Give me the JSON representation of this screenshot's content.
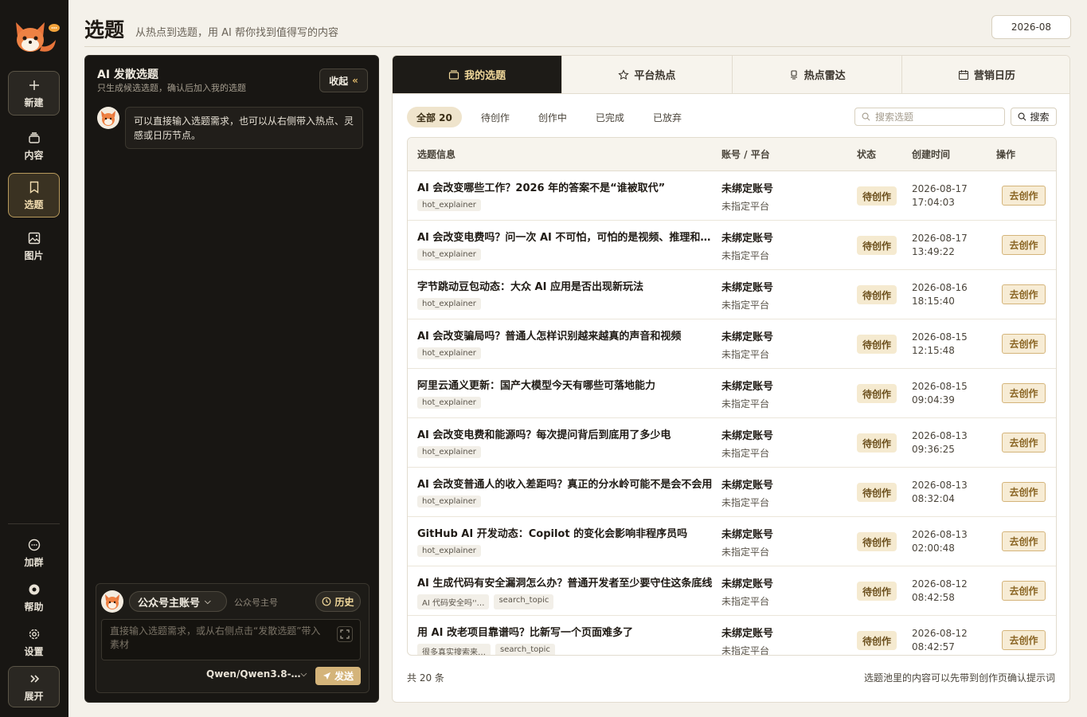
{
  "sidebar": {
    "new_label": "新建",
    "content_label": "内容",
    "topics_label": "选题",
    "images_label": "图片",
    "join_group_label": "加群",
    "help_label": "帮助",
    "settings_label": "设置",
    "expand_label": "展开"
  },
  "header": {
    "title": "选题",
    "subtitle": "从热点到选题，用 AI 帮你找到值得写的内容",
    "date": "2026-08"
  },
  "ai_panel": {
    "title": "AI 发散选题",
    "subtitle": "只生成候选选题，确认后加入我的选题",
    "collapse_label": "收起",
    "message": "可以直接输入选题需求，也可以从右侧带入热点、灵感或日历节点。",
    "account_name": "公众号主账号",
    "account_type": "公众号主号",
    "history_label": "历史",
    "input_placeholder": "直接输入选题需求，或从右侧点击“发散选题”带入素材",
    "model": "Qwen/Qwen3.8-…",
    "send_label": "发送"
  },
  "tabs": [
    {
      "label": "我的选题",
      "icon": "folder-icon"
    },
    {
      "label": "平台热点",
      "icon": "star-icon"
    },
    {
      "label": "热点雷达",
      "icon": "radar-icon"
    },
    {
      "label": "营销日历",
      "icon": "calendar-icon"
    }
  ],
  "filters": [
    "全部 20",
    "待创作",
    "创作中",
    "已完成",
    "已放弃"
  ],
  "search": {
    "placeholder": "搜索选题",
    "button_label": "搜索"
  },
  "table": {
    "headers": {
      "info": "选题信息",
      "account": "账号 / 平台",
      "status": "状态",
      "created": "创建时间",
      "action": "操作"
    },
    "rows": [
      {
        "title": "AI 会改变哪些工作？2026 年的答案不是“谁被取代”",
        "tags": [
          "hot_explainer"
        ],
        "account": "未绑定账号",
        "platform": "未指定平台",
        "status": "待创作",
        "date": "2026-08-17",
        "time": "17:04:03",
        "action": "去创作"
      },
      {
        "title": "AI 会改变电费吗？问一次 AI 不可怕，可怕的是视频、推理和智…",
        "tags": [
          "hot_explainer"
        ],
        "account": "未绑定账号",
        "platform": "未指定平台",
        "status": "待创作",
        "date": "2026-08-17",
        "time": "13:49:22",
        "action": "去创作"
      },
      {
        "title": "字节跳动豆包动态：大众 AI 应用是否出现新玩法",
        "tags": [
          "hot_explainer"
        ],
        "account": "未绑定账号",
        "platform": "未指定平台",
        "status": "待创作",
        "date": "2026-08-16",
        "time": "18:15:40",
        "action": "去创作"
      },
      {
        "title": "AI 会改变骗局吗？普通人怎样识别越来越真的声音和视频",
        "tags": [
          "hot_explainer"
        ],
        "account": "未绑定账号",
        "platform": "未指定平台",
        "status": "待创作",
        "date": "2026-08-15",
        "time": "12:15:48",
        "action": "去创作"
      },
      {
        "title": "阿里云通义更新：国产大模型今天有哪些可落地能力",
        "tags": [
          "hot_explainer"
        ],
        "account": "未绑定账号",
        "platform": "未指定平台",
        "status": "待创作",
        "date": "2026-08-15",
        "time": "09:04:39",
        "action": "去创作"
      },
      {
        "title": "AI 会改变电费和能源吗？每次提问背后到底用了多少电",
        "tags": [
          "hot_explainer"
        ],
        "account": "未绑定账号",
        "platform": "未指定平台",
        "status": "待创作",
        "date": "2026-08-13",
        "time": "09:36:25",
        "action": "去创作"
      },
      {
        "title": "AI 会改变普通人的收入差距吗？真正的分水岭可能不是会不会用",
        "tags": [
          "hot_explainer"
        ],
        "account": "未绑定账号",
        "platform": "未指定平台",
        "status": "待创作",
        "date": "2026-08-13",
        "time": "08:32:04",
        "action": "去创作"
      },
      {
        "title": "GitHub AI 开发动态：Copilot 的变化会影响非程序员吗",
        "tags": [
          "hot_explainer"
        ],
        "account": "未绑定账号",
        "platform": "未指定平台",
        "status": "待创作",
        "date": "2026-08-13",
        "time": "02:00:48",
        "action": "去创作"
      },
      {
        "title": "AI 生成代码有安全漏洞怎么办？普通开发者至少要守住这条底线",
        "tags": [
          "AI 代码安全吗''…",
          "search_topic"
        ],
        "account": "未绑定账号",
        "platform": "未指定平台",
        "status": "待创作",
        "date": "2026-08-12",
        "time": "08:42:58",
        "action": "去创作"
      },
      {
        "title": "用 AI 改老项目靠谱吗？比新写一个页面难多了",
        "tags": [
          "很多真实搜索来…",
          "search_topic"
        ],
        "account": "未绑定账号",
        "platform": "未指定平台",
        "status": "待创作",
        "date": "2026-08-12",
        "time": "08:42:57",
        "action": "去创作"
      }
    ]
  },
  "footer": {
    "total": "共 20 条",
    "note": "选题池里的内容可以先带到创作页确认提示词"
  },
  "colors": {
    "accent": "#d4b47a",
    "dark": "#181613",
    "gold_text": "#f0d79a"
  }
}
